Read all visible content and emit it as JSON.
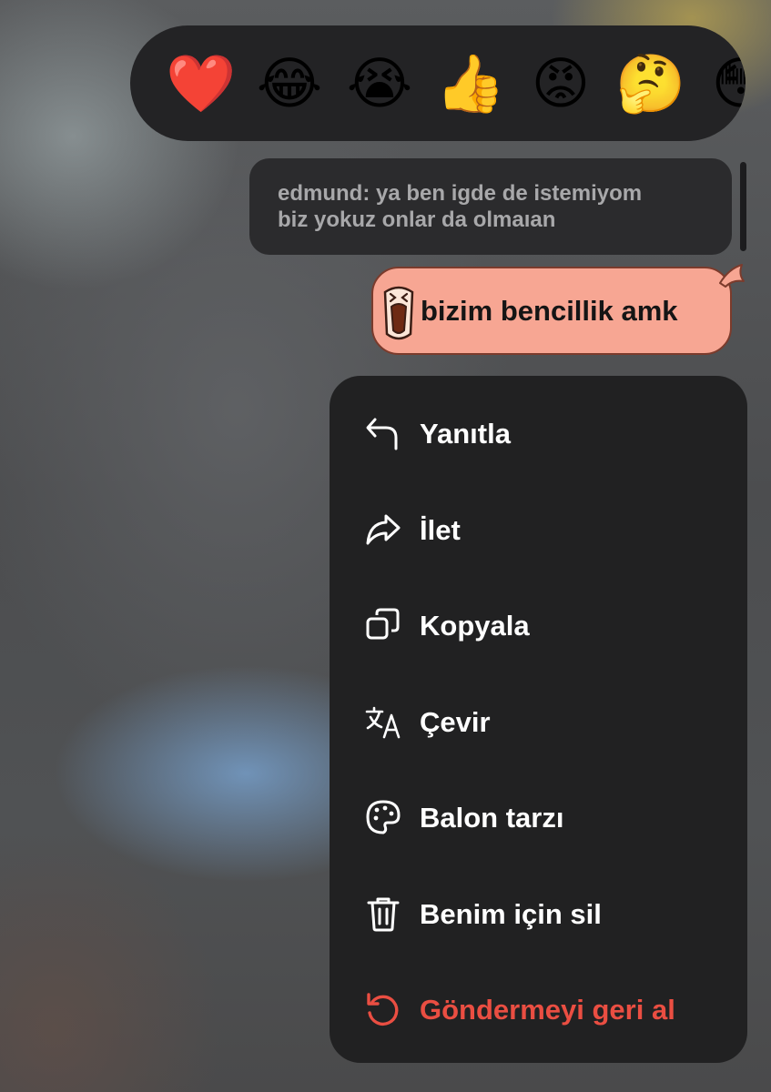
{
  "reactions": [
    {
      "icon": "red-heart",
      "glyph": "❤️"
    },
    {
      "icon": "tears-of-joy",
      "glyph": "😂"
    },
    {
      "icon": "loudly-crying",
      "glyph": "😭"
    },
    {
      "icon": "thumbs-up",
      "glyph": "👍"
    },
    {
      "icon": "angry-face",
      "glyph": "😡"
    },
    {
      "icon": "thinking-face",
      "glyph": "🤔"
    },
    {
      "icon": "flushed-face",
      "glyph": "😳"
    }
  ],
  "quoted_message": {
    "line1": "edmund: ya ben igde de istemiyom",
    "line2": "biz yokuz onlar da olmaıan"
  },
  "message": {
    "text": "bizim bencillik amk",
    "bubble_color": "#f7a693",
    "sticker": "shouting-face-sticker"
  },
  "menu": {
    "items": [
      {
        "label": "Yanıtla",
        "icon": "reply-arrow-icon"
      },
      {
        "label": "İlet",
        "icon": "forward-arrow-icon"
      },
      {
        "label": "Kopyala",
        "icon": "copy-icon"
      },
      {
        "label": "Çevir",
        "icon": "translate-icon"
      },
      {
        "label": "Balon tarzı",
        "icon": "palette-icon"
      },
      {
        "label": "Benim için sil",
        "icon": "trash-icon"
      },
      {
        "label": "Göndermeyi geri al",
        "icon": "undo-icon",
        "danger": true
      }
    ]
  },
  "colors": {
    "menu_background": "#212122",
    "danger": "#ea4e42",
    "text": "#ffffff"
  }
}
